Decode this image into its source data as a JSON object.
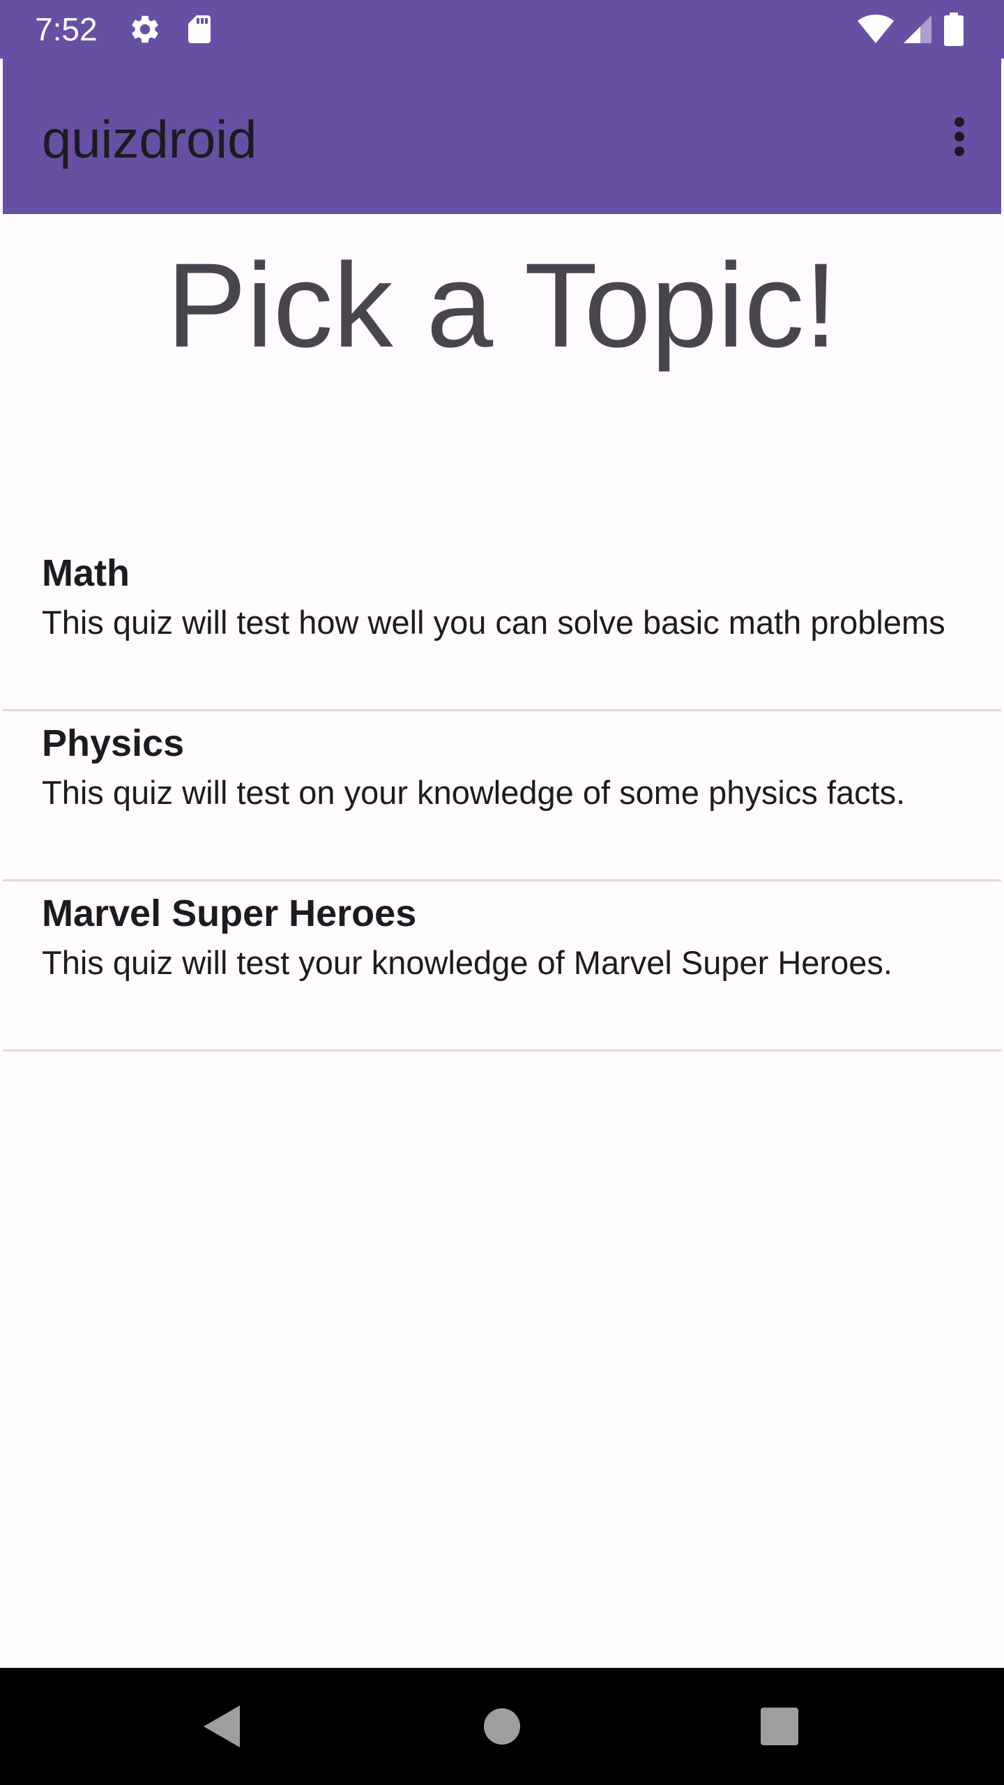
{
  "status_bar": {
    "time": "7:52",
    "icons": [
      "gear-icon",
      "sd-card-icon",
      "wifi-icon",
      "signal-icon",
      "battery-icon"
    ]
  },
  "app_bar": {
    "title": "quizdroid",
    "background_color": "#6750a4",
    "menu_icon": "more-vert-icon"
  },
  "main": {
    "heading": "Pick a Topic!",
    "topics": [
      {
        "title": "Math",
        "description": "This quiz will test how well you can solve basic math problems"
      },
      {
        "title": "Physics",
        "description": "This quiz will test on your knowledge of some physics facts."
      },
      {
        "title": "Marvel Super Heroes",
        "description": "This quiz will test your knowledge of Marvel Super Heroes."
      }
    ]
  },
  "nav_bar": {
    "buttons": [
      "back-icon",
      "home-icon",
      "recents-icon"
    ]
  }
}
